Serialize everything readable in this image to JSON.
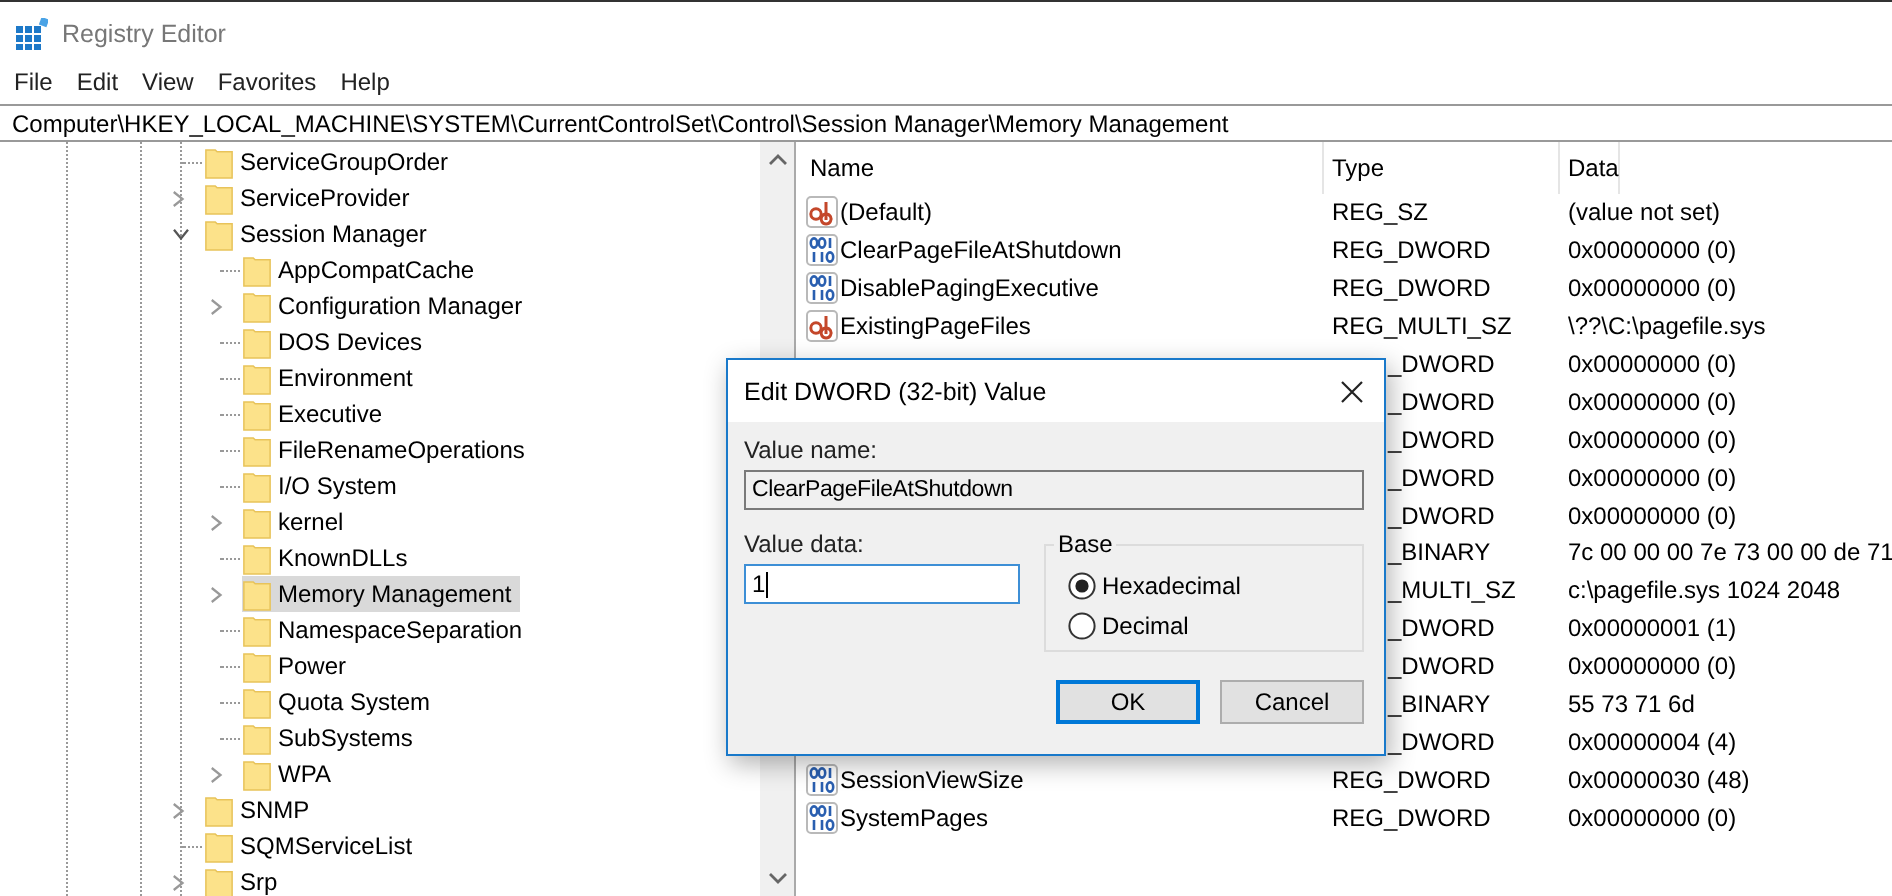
{
  "window": {
    "title": "Registry Editor"
  },
  "menu": [
    "File",
    "Edit",
    "View",
    "Favorites",
    "Help"
  ],
  "address": "Computer\\HKEY_LOCAL_MACHINE\\SYSTEM\\CurrentControlSet\\Control\\Session Manager\\Memory Management",
  "tree": [
    {
      "label": "ServiceGroupOrder",
      "has_children": false,
      "expanded": false,
      "selected": false
    },
    {
      "label": "ServiceProvider",
      "has_children": true,
      "expanded": false,
      "selected": false
    },
    {
      "label": "Session Manager",
      "has_children": true,
      "expanded": true,
      "selected": false,
      "children": [
        {
          "label": "AppCompatCache",
          "has_children": false,
          "expanded": false,
          "selected": false
        },
        {
          "label": "Configuration Manager",
          "has_children": true,
          "expanded": false,
          "selected": false
        },
        {
          "label": "DOS Devices",
          "has_children": false,
          "expanded": false,
          "selected": false
        },
        {
          "label": "Environment",
          "has_children": false,
          "expanded": false,
          "selected": false
        },
        {
          "label": "Executive",
          "has_children": false,
          "expanded": false,
          "selected": false
        },
        {
          "label": "FileRenameOperations",
          "has_children": false,
          "expanded": false,
          "selected": false
        },
        {
          "label": "I/O System",
          "has_children": false,
          "expanded": false,
          "selected": false
        },
        {
          "label": "kernel",
          "has_children": true,
          "expanded": false,
          "selected": false
        },
        {
          "label": "KnownDLLs",
          "has_children": false,
          "expanded": false,
          "selected": false
        },
        {
          "label": "Memory Management",
          "has_children": true,
          "expanded": false,
          "selected": true
        },
        {
          "label": "NamespaceSeparation",
          "has_children": false,
          "expanded": false,
          "selected": false
        },
        {
          "label": "Power",
          "has_children": false,
          "expanded": false,
          "selected": false
        },
        {
          "label": "Quota System",
          "has_children": false,
          "expanded": false,
          "selected": false
        },
        {
          "label": "SubSystems",
          "has_children": false,
          "expanded": false,
          "selected": false
        },
        {
          "label": "WPA",
          "has_children": true,
          "expanded": false,
          "selected": false
        }
      ]
    },
    {
      "label": "SNMP",
      "has_children": true,
      "expanded": false,
      "selected": false
    },
    {
      "label": "SQMServiceList",
      "has_children": false,
      "expanded": false,
      "selected": false
    },
    {
      "label": "Srp",
      "has_children": true,
      "expanded": false,
      "selected": false
    }
  ],
  "table": {
    "columns": [
      "Name",
      "Type",
      "Data"
    ],
    "rows": [
      {
        "kind": "string",
        "name": "(Default)",
        "type": "REG_SZ",
        "data": "(value not set)"
      },
      {
        "kind": "binary",
        "name": "ClearPageFileAtShutdown",
        "type": "REG_DWORD",
        "data": "0x00000000 (0)"
      },
      {
        "kind": "binary",
        "name": "DisablePagingExecutive",
        "type": "REG_DWORD",
        "data": "0x00000000 (0)"
      },
      {
        "kind": "string",
        "name": "ExistingPageFiles",
        "type": "REG_MULTI_SZ",
        "data": "\\??\\C:\\pagefile.sys"
      },
      {
        "kind": "covered",
        "type": "_DWORD",
        "data": "0x00000000 (0)"
      },
      {
        "kind": "covered",
        "type": "_DWORD",
        "data": "0x00000000 (0)"
      },
      {
        "kind": "covered",
        "type": "_DWORD",
        "data": "0x00000000 (0)"
      },
      {
        "kind": "covered",
        "type": "_DWORD",
        "data": "0x00000000 (0)"
      },
      {
        "kind": "covered",
        "type": "_DWORD",
        "data": "0x00000000 (0)"
      },
      {
        "kind": "covered",
        "type": "_BINARY",
        "data": "7c 00 00 00 7e 73 00 00 de 71"
      },
      {
        "kind": "covered",
        "type": "_MULTI_SZ",
        "data": "c:\\pagefile.sys 1024 2048"
      },
      {
        "kind": "covered",
        "type": "_DWORD",
        "data": "0x00000001 (1)"
      },
      {
        "kind": "covered",
        "type": "_DWORD",
        "data": "0x00000000 (0)"
      },
      {
        "kind": "covered",
        "type": "_BINARY",
        "data": "55 73 71 6d"
      },
      {
        "kind": "covered",
        "type": "_DWORD",
        "data": "0x00000004 (4)"
      },
      {
        "kind": "binary",
        "name": "SessionViewSize",
        "type": "REG_DWORD",
        "data": "0x00000030 (48)"
      },
      {
        "kind": "binary",
        "name": "SystemPages",
        "type": "REG_DWORD",
        "data": "0x00000000 (0)"
      }
    ]
  },
  "dialog": {
    "title": "Edit DWORD (32-bit) Value",
    "name_label": "Value name:",
    "name_value": "ClearPageFileAtShutdown",
    "data_label": "Value data:",
    "data_value": "1",
    "base_label": "Base",
    "bases": [
      {
        "label": "Hexadecimal",
        "selected": true
      },
      {
        "label": "Decimal",
        "selected": false
      }
    ],
    "buttons": [
      "OK",
      "Cancel"
    ]
  }
}
